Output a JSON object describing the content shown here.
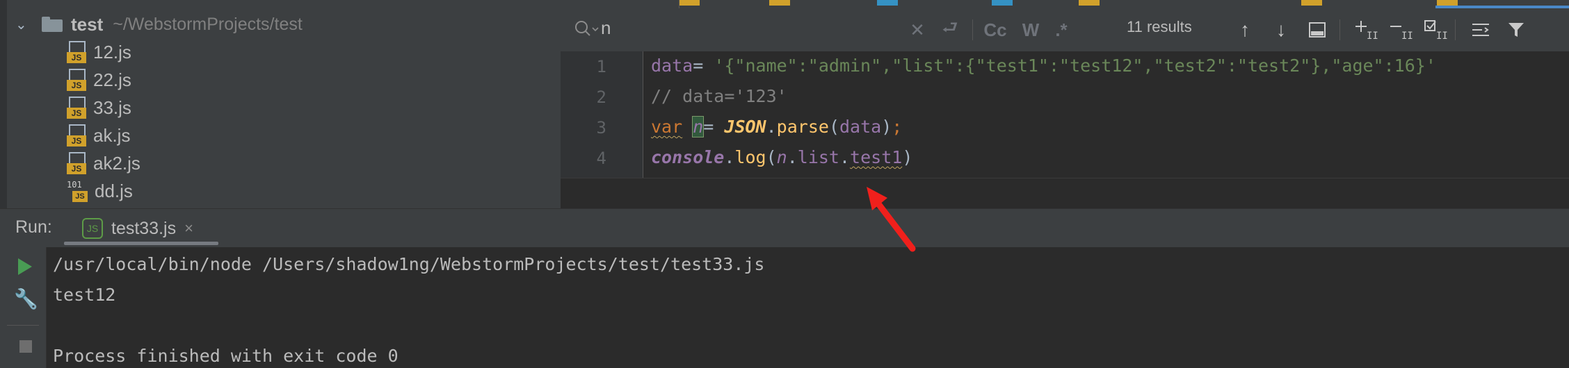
{
  "project": {
    "root_name": "test",
    "root_path": "~/WebstormProjects/test",
    "files": [
      {
        "name": "12.js",
        "icon": "js-file-icon"
      },
      {
        "name": "22.js",
        "icon": "js-file-icon"
      },
      {
        "name": "33.js",
        "icon": "js-file-icon"
      },
      {
        "name": "ak.js",
        "icon": "js-file-icon"
      },
      {
        "name": "ak2.js",
        "icon": "js-file-icon"
      },
      {
        "name": "dd.js",
        "icon": "binary-js-file-icon"
      }
    ],
    "js_badge": "JS",
    "binary_badge": "101"
  },
  "search": {
    "query": "n",
    "results": "11 results",
    "match_case": "Cc",
    "words": "W",
    "regex": ".*"
  },
  "editor": {
    "line_numbers": [
      "1",
      "2",
      "3",
      "4"
    ],
    "line1": {
      "var": "data",
      "op": "= ",
      "str": "'{\"name\":\"admin\",\"list\":{\"test1\":\"test12\",\"test2\":\"test2\"},\"age\":16}'"
    },
    "line2": {
      "comment": "// data='123'"
    },
    "line3": {
      "kw": "var",
      "sp": " ",
      "ident": "n",
      "op": "= ",
      "obj": "JSON",
      "dot": ".",
      "fn": "parse",
      "open": "(",
      "arg": "data",
      "close": ")",
      "semi": ";"
    },
    "line4": {
      "obj": "console",
      "dot1": ".",
      "fn": "log",
      "open": "(",
      "n": "n",
      "dot2": ".",
      "prop1": "list",
      "dot3": ".",
      "prop2": "test1",
      "close": ")"
    }
  },
  "run": {
    "label": "Run:",
    "tab_name": "test33.js",
    "tab_icon": "JS",
    "close": "×",
    "console_lines": [
      "/usr/local/bin/node /Users/shadow1ng/WebstormProjects/test/test33.js",
      "test12",
      "",
      "Process finished with exit code 0"
    ]
  },
  "colors": {
    "accent_tab": "#4a88c7",
    "js_badge": "#d1a12b",
    "run_green": "#499c54",
    "arrow_red": "#f0201c"
  }
}
